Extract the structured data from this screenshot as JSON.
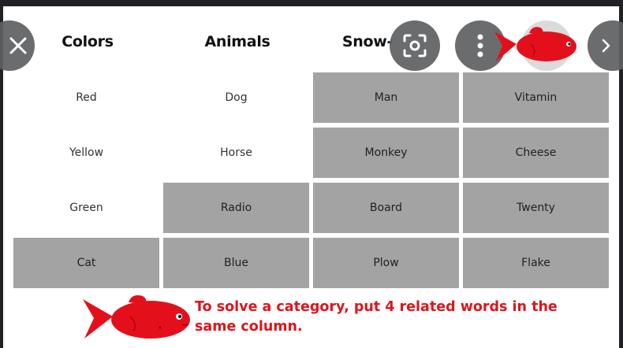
{
  "headers": [
    "Colors",
    "Animals",
    "Snow-"
  ],
  "grid": [
    [
      {
        "text": "Red",
        "solved": false
      },
      {
        "text": "Dog",
        "solved": false
      },
      {
        "text": "Man",
        "solved": true
      },
      {
        "text": "Vitamin",
        "solved": true
      }
    ],
    [
      {
        "text": "Yellow",
        "solved": false
      },
      {
        "text": "Horse",
        "solved": false
      },
      {
        "text": "Monkey",
        "solved": true
      },
      {
        "text": "Cheese",
        "solved": true
      }
    ],
    [
      {
        "text": "Green",
        "solved": false
      },
      {
        "text": "Radio",
        "solved": true
      },
      {
        "text": "Board",
        "solved": true
      },
      {
        "text": "Twenty",
        "solved": true
      }
    ],
    [
      {
        "text": "Cat",
        "solved": true
      },
      {
        "text": "Blue",
        "solved": true
      },
      {
        "text": "Plow",
        "solved": true
      },
      {
        "text": "Flake",
        "solved": true
      }
    ]
  ],
  "hint": {
    "line1": "To solve a category, put 4 related words in the",
    "line2": "same column."
  },
  "overlay": {
    "close_icon": "close-icon",
    "lens_icon": "lens-scan-icon",
    "more_icon": "more-vert-icon",
    "prev_icon": "chevron-left-icon",
    "next_icon": "chevron-right-icon"
  },
  "colors": {
    "solved_cell": "#a3a3a3",
    "hint_text": "#e0141c",
    "fish": "#e3101b",
    "overlay_button": "#5f6062"
  }
}
